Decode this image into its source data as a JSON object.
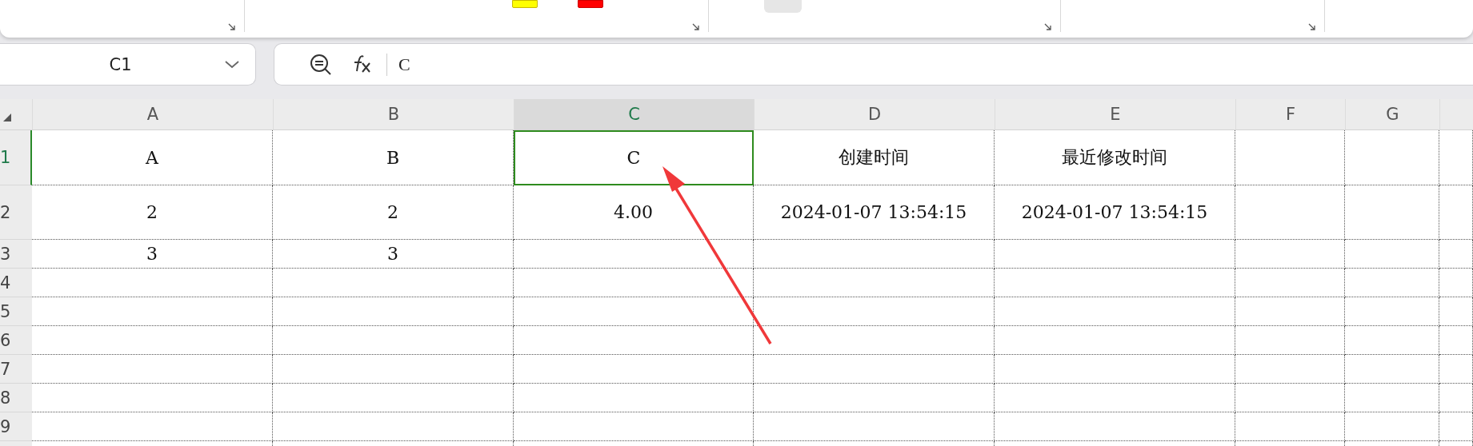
{
  "name_box": {
    "value": "C1"
  },
  "formula_bar": {
    "value": "C"
  },
  "columns": [
    {
      "label": "A",
      "selected": false
    },
    {
      "label": "B",
      "selected": false
    },
    {
      "label": "C",
      "selected": true
    },
    {
      "label": "D",
      "selected": false
    },
    {
      "label": "E",
      "selected": false
    },
    {
      "label": "F",
      "selected": false
    },
    {
      "label": "G",
      "selected": false
    },
    {
      "selected": false
    }
  ],
  "rows": [
    {
      "number": "1",
      "selected": true,
      "cells": [
        "A",
        "B",
        "C",
        "创建时间",
        "最近修改时间"
      ]
    },
    {
      "number": "2",
      "selected": false,
      "cells": [
        "2",
        "2",
        "4.00",
        "2024-01-07 13:54:15",
        "2024-01-07 13:54:15"
      ]
    },
    {
      "number": "3",
      "selected": false,
      "cells": [
        "3",
        "3"
      ]
    },
    {
      "number": "4",
      "selected": false
    },
    {
      "number": "5",
      "selected": false
    },
    {
      "number": "6",
      "selected": false
    },
    {
      "number": "7",
      "selected": false
    },
    {
      "number": "8",
      "selected": false
    },
    {
      "number": "9",
      "selected": false
    },
    {
      "selected": false
    }
  ]
}
